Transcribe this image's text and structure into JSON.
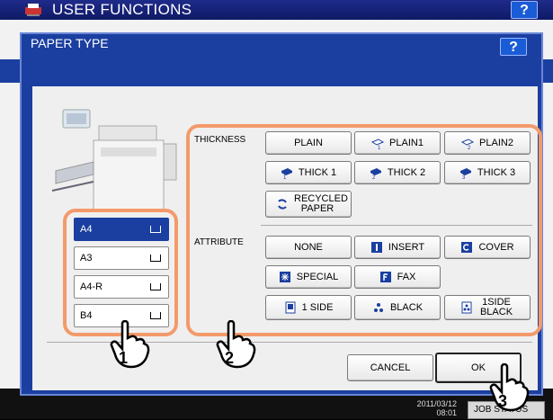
{
  "app": {
    "title": "USER FUNCTIONS",
    "help": "?"
  },
  "dialog": {
    "title": "PAPER TYPE",
    "help": "?"
  },
  "paper_sizes": [
    {
      "label": "A4",
      "selected": true
    },
    {
      "label": "A3",
      "selected": false
    },
    {
      "label": "A4-R",
      "selected": false
    },
    {
      "label": "B4",
      "selected": false
    }
  ],
  "thickness": {
    "label": "THICKNESS",
    "buttons": [
      "PLAIN",
      "PLAIN1",
      "PLAIN2",
      "THICK 1",
      "THICK 2",
      "THICK 3",
      "RECYCLED PAPER"
    ]
  },
  "attribute": {
    "label": "ATTRIBUTE",
    "buttons": [
      "NONE",
      "INSERT",
      "COVER",
      "SPECIAL",
      "FAX",
      "1 SIDE",
      "BLACK",
      "1SIDE BLACK"
    ]
  },
  "actions": {
    "cancel": "CANCEL",
    "ok": "OK"
  },
  "callouts": [
    "1",
    "2",
    "3"
  ],
  "status": {
    "clock_date": "2011/03/12",
    "clock_time": "08:01",
    "job_status": "JOB STATUS"
  },
  "colors": {
    "accent": "#1b3fa0",
    "callout_ring": "#f39a6b"
  }
}
